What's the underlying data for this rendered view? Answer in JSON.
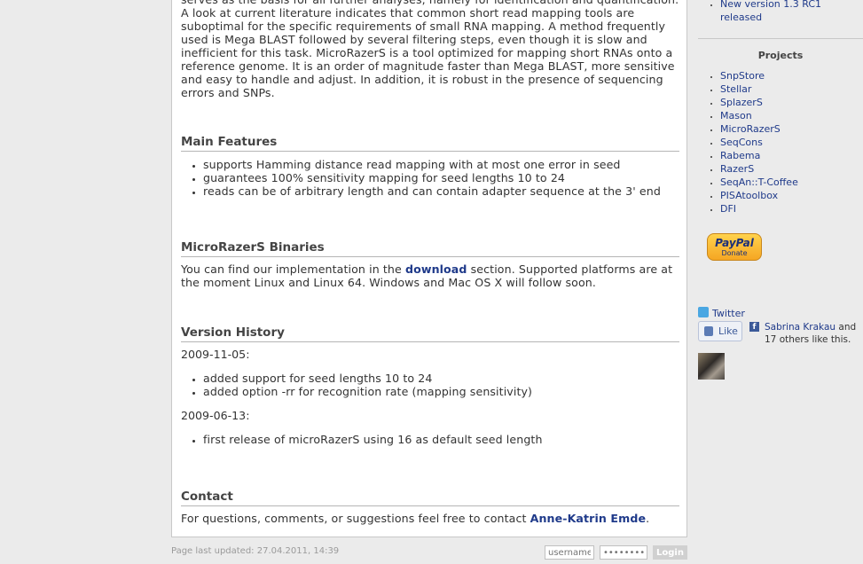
{
  "intro": "serves as the basis for all further analyses, namely for identification and quantification. A look at current literature indicates that common short read mapping tools are suboptimal for the specific requirements of small RNA mapping. A method frequently used is Mega BLAST followed by several filtering steps, even though it is slow and inefficient for this task. MicroRazerS is a tool optimized for mapping short RNAs onto a reference genome. It is an order of magnitude faster than Mega BLAST, more sensitive and easy to handle and adjust. In addition, it is robust in the presence of sequencing errors and SNPs.",
  "features": {
    "heading": "Main Features",
    "items": [
      "supports Hamming distance read mapping with at most one error in seed",
      "guarantees 100% sensitivity mapping for seed lengths 10 to 24",
      "reads can be of arbitrary length and can contain adapter sequence at the 3' end"
    ]
  },
  "binaries": {
    "heading": "MicroRazerS Binaries",
    "text_before": "You can find our implementation in the ",
    "link": "download",
    "text_after": " section. Supported platforms are at the moment Linux and Linux 64. Windows and Mac OS X will follow soon."
  },
  "history": {
    "heading": "Version History",
    "entries": [
      {
        "date": "2009-11-05:",
        "items": [
          "added support for seed lengths 10 to 24",
          "added option -rr for recognition rate (mapping sensitivity)"
        ]
      },
      {
        "date": "2009-06-13:",
        "items": [
          "first release of microRazerS using 16 as default seed length"
        ]
      }
    ]
  },
  "contact": {
    "heading": "Contact",
    "text": "For questions, comments, or suggestions feel free to contact ",
    "link": "Anne-Katrin Emde",
    "end": "."
  },
  "footer": {
    "updated": "Page last updated: 27.04.2011, 14:39",
    "username_placeholder": "username",
    "password_placeholder": "••••••••",
    "login": "Login"
  },
  "sidebar": {
    "news_item": "New version 1.3 RC1 released",
    "projects_title": "Projects",
    "projects": [
      "SnpStore",
      "Stellar",
      "SplazerS",
      "Mason",
      "MicroRazerS",
      "SeqCons",
      "Rabema",
      "RazerS",
      "SeqAn::T-Coffee",
      "PISAtoolbox",
      "DFI"
    ],
    "paypal_label": "PayPal",
    "paypal_sub": "Donate",
    "twitter": "Twitter",
    "like": "Like",
    "fb_name": "Sabrina Krakau",
    "fb_rest": " and 17 others like this."
  },
  "colors": {
    "link": "#1f3a8a",
    "background": "#ebebeb"
  }
}
